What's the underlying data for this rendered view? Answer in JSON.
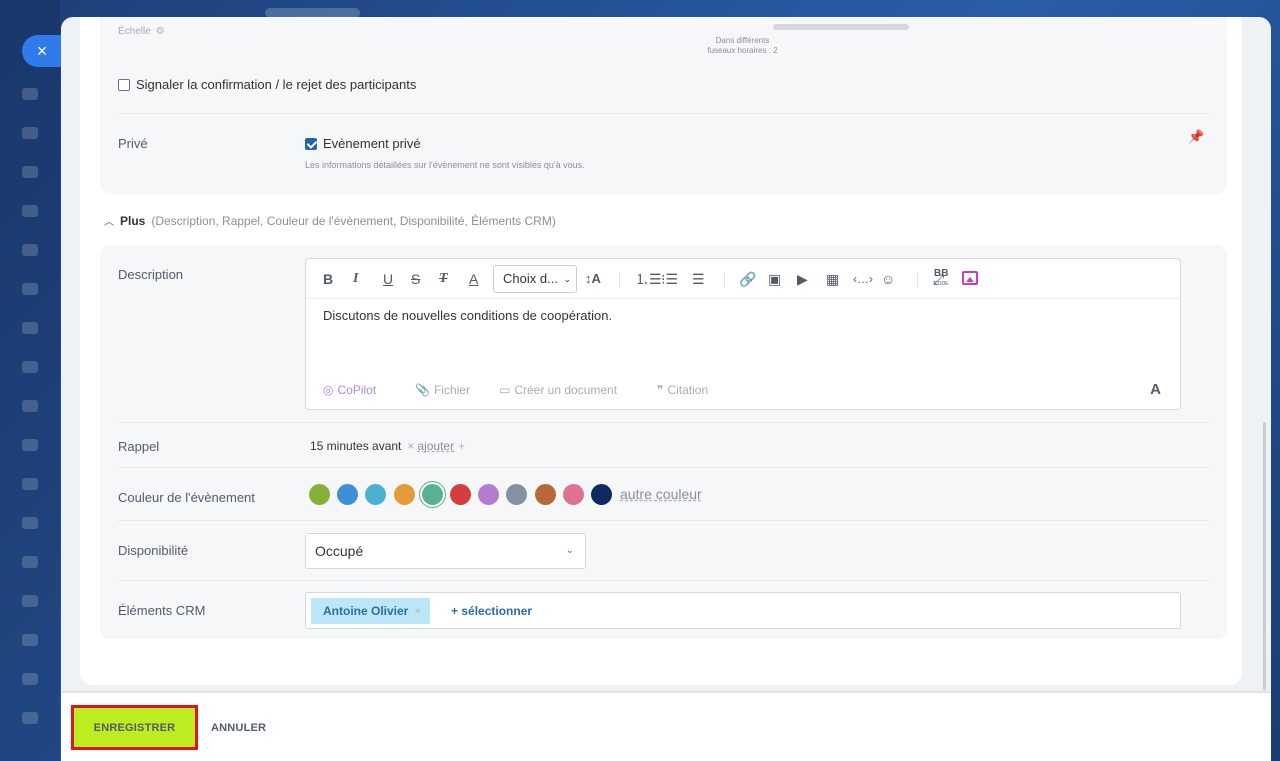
{
  "window": {
    "close_glyph": "×"
  },
  "top_section": {
    "scale_label": "Échelle",
    "timezone_note_line1": "Dans différents",
    "timezone_note_line2": "fuseaux horaires : 2",
    "notify_label": "Signaler la confirmation / le rejet des participants",
    "notify_checked": false,
    "private_label": "Privé",
    "private_checkbox_label": "Evènement privé",
    "private_checked": true,
    "private_hint": "Les informations détaillées sur l'évènement ne sont visibles qu'à vous."
  },
  "more": {
    "title": "Plus",
    "summary": "(Description, Rappel, Couleur de l'évènement, Disponibilité, Éléments CRM)"
  },
  "description": {
    "label": "Description",
    "font_select": "Choix d...",
    "text": "Discutons de nouvelles conditions de coopération.",
    "footer": {
      "copilot": "CoPilot",
      "file": "Fichier",
      "create_doc": "Créer un document",
      "quote": "Citation",
      "format_toggle": "A"
    },
    "toolbar": {
      "bold": "B",
      "italic": "I",
      "underline": "U",
      "strike": "S",
      "clear": "T",
      "color": "A",
      "font_size": "↕A",
      "bbcode": "BB",
      "bbcode_sub": "CODE"
    }
  },
  "reminder": {
    "label": "Rappel",
    "value": "15 minutes avant",
    "remove": "×",
    "add": "ajouter",
    "add_plus": "+"
  },
  "color": {
    "label": "Couleur de l'évènement",
    "swatches": [
      "#86b137",
      "#3e8fd8",
      "#4bb1cf",
      "#e59b38",
      "#57b38f",
      "#d63d3d",
      "#b57cce",
      "#8590a0",
      "#b96837",
      "#dd7291",
      "#0e2a63"
    ],
    "selected_index": 4,
    "other_link": "autre couleur"
  },
  "availability": {
    "label": "Disponibilité",
    "value": "Occupé"
  },
  "crm": {
    "label": "Éléments CRM",
    "tag": "Antoine Olivier",
    "tag_remove": "×",
    "select_link": "+ sélectionner"
  },
  "footer": {
    "save": "ENREGISTRER",
    "cancel": "ANNULER"
  }
}
